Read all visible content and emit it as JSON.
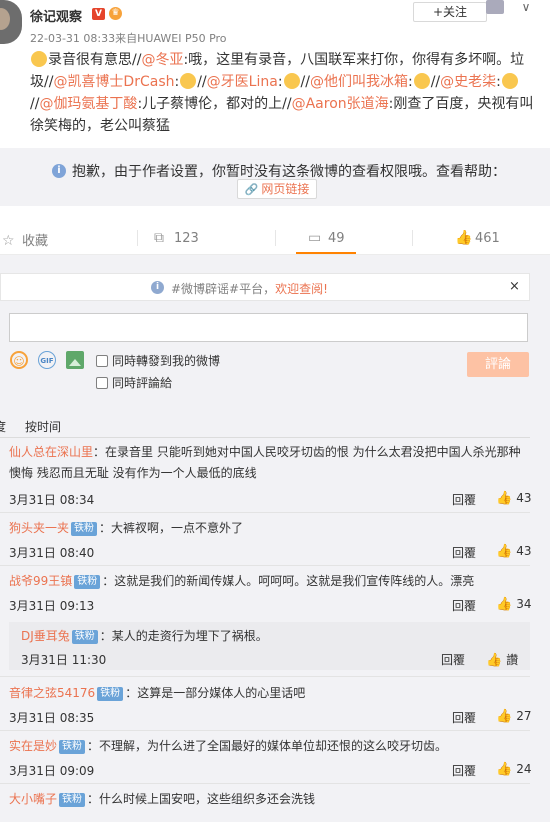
{
  "post": {
    "author": "徐记观察",
    "verified_badge": "V",
    "follow_label": "+关注",
    "time_source": "22-03-31 08:33来自HUAWEI P50 Pro",
    "content": {
      "p1": "录音很有意思//",
      "u1": "@冬亚",
      "p2": ":哦，这里有录音，八国联军来打你，你得有多坏啊。垃圾//",
      "u2": "@凯喜博士DrCash",
      "p3": ":",
      "p4": "//",
      "u3": "@牙医Lina",
      "p5": ":",
      "p6": "//",
      "u4": "@他们叫我冰箱",
      "p7": ":",
      "p8": "//",
      "u5": "@史老柒",
      "p9": ":",
      "p10": "//",
      "u6": "@伽玛氨基丁酸",
      "p11": ":儿子蔡博伦，都对的上//",
      "u7": "@Aaron张道海",
      "p12": ":刚查了百度，央视有叫徐笑梅的，老公叫蔡猛"
    }
  },
  "forbidden": {
    "message": "抱歉，由于作者设置，你暂时没有这条微博的查看权限哦。查看帮助：",
    "link_label": "网页链接"
  },
  "actions": {
    "favorite_label": "收藏",
    "repost_count": "123",
    "comment_count": "49",
    "like_count": "461"
  },
  "notice": {
    "prefix": "#微博辟谣#平台，",
    "highlight": "欢迎查阅!",
    "close": "×"
  },
  "composer": {
    "gif_label": "GIF",
    "repost_check_label": "同時轉發到我的微博",
    "comment_check_label": "同時評論給",
    "submit_label": "評論"
  },
  "sort": {
    "hot": "度",
    "by_time": "按时间"
  },
  "comments": [
    {
      "user": "仙人总在深山里",
      "badge": "",
      "text": "：在录音里 只能听到她对中国人民咬牙切齿的恨 为什么太君没把中国人杀光那种懊悔 残忍而且无耻 没有作为一个人最低的底线",
      "time": "3月31日 08:34",
      "reply": "回覆",
      "likes": "43"
    },
    {
      "user": "狗头夹一夹",
      "badge": "铁粉",
      "text": "：大裤衩啊，一点不意外了",
      "time": "3月31日 08:40",
      "reply": "回覆",
      "likes": "43"
    },
    {
      "user": "战爷99王镇",
      "badge": "铁粉",
      "text": "：这就是我们的新闻传媒人。呵呵呵。这就是我们宣传阵线的人。漂亮",
      "time": "3月31日 09:13",
      "reply": "回覆",
      "likes": "34"
    },
    {
      "user": "DJ垂耳兔",
      "badge": "铁粉",
      "text": "：某人的走资行为埋下了祸根。",
      "time": "3月31日 11:30",
      "reply": "回覆",
      "likes": "讚"
    },
    {
      "user": "音律之弦54176",
      "badge": "铁粉",
      "text": "：这算是一部分媒体人的心里话吧",
      "time": "3月31日 08:35",
      "reply": "回覆",
      "likes": "27"
    },
    {
      "user": "实在是妙",
      "badge": "铁粉",
      "text": "：不理解，为什么进了全国最好的媒体单位却还恨的这么咬牙切齿。",
      "time": "3月31日 09:09",
      "reply": "回覆",
      "likes": "24"
    },
    {
      "user": "大小嘴子",
      "badge": "铁粉",
      "text": "：什么时候上国安吧，这些组织多还会洗钱",
      "time": "",
      "reply": "",
      "likes": ""
    }
  ]
}
